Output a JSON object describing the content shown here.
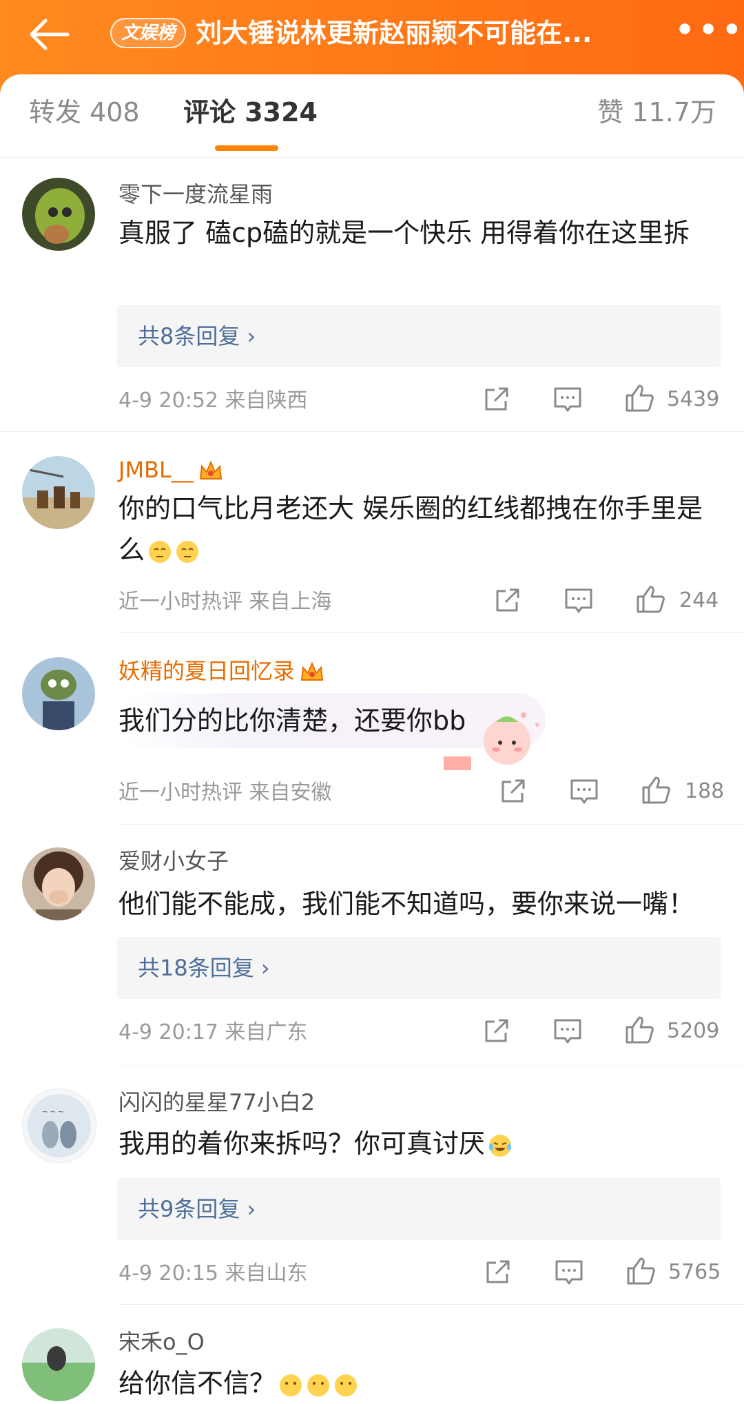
{
  "header": {
    "badge": "文娱榜",
    "title": "刘大锤说林更新赵丽颖不可能在...",
    "more": "•••"
  },
  "tabs": [
    {
      "label": "转发 408"
    },
    {
      "label": "评论 3324"
    },
    {
      "label": "赞 11.7万"
    }
  ],
  "comments": [
    {
      "user": "零下一度流星雨",
      "text": "真服了  磕cp磕的就是一个快乐  用得着你在这里拆",
      "replies": "共8条回复",
      "meta": "4-9 20:52  来自陕西",
      "likes": "5439"
    },
    {
      "user": "JMBL__",
      "text": "你的口气比月老还大 娱乐圈的红线都拽在你手里是么",
      "meta": "近一小时热评  来自上海",
      "likes": "244"
    },
    {
      "user": "妖精的夏日回忆录",
      "text": "我们分的比你清楚，还要你bb",
      "meta": "近一小时热评  来自安徽",
      "likes": "188"
    },
    {
      "user": "爱财小女子",
      "text": "他们能不能成，我们能不知道吗，要你来说一嘴！",
      "replies": "共18条回复",
      "meta": "4-9 20:17  来自广东",
      "likes": "5209"
    },
    {
      "user": "闪闪的星星77小白2",
      "text": "我用的着你来拆吗？你可真讨厌",
      "replies": "共9条回复",
      "meta": "4-9 20:15  来自山东",
      "likes": "5765"
    },
    {
      "user": "宋禾o_O",
      "text": "给你信不信？"
    }
  ],
  "icons": {
    "back": "back-arrow-icon",
    "share": "share-icon",
    "comment": "comment-icon",
    "like": "thumbs-up-icon",
    "crown": "crown-icon",
    "chevron": "chevron-right-icon"
  },
  "colors": {
    "header_start": "#ff8a1f",
    "header_end": "#ff6a12",
    "tab_indicator": "#ff8200",
    "vip_name": "#e86b00",
    "reply_link": "#4f6f9a"
  }
}
